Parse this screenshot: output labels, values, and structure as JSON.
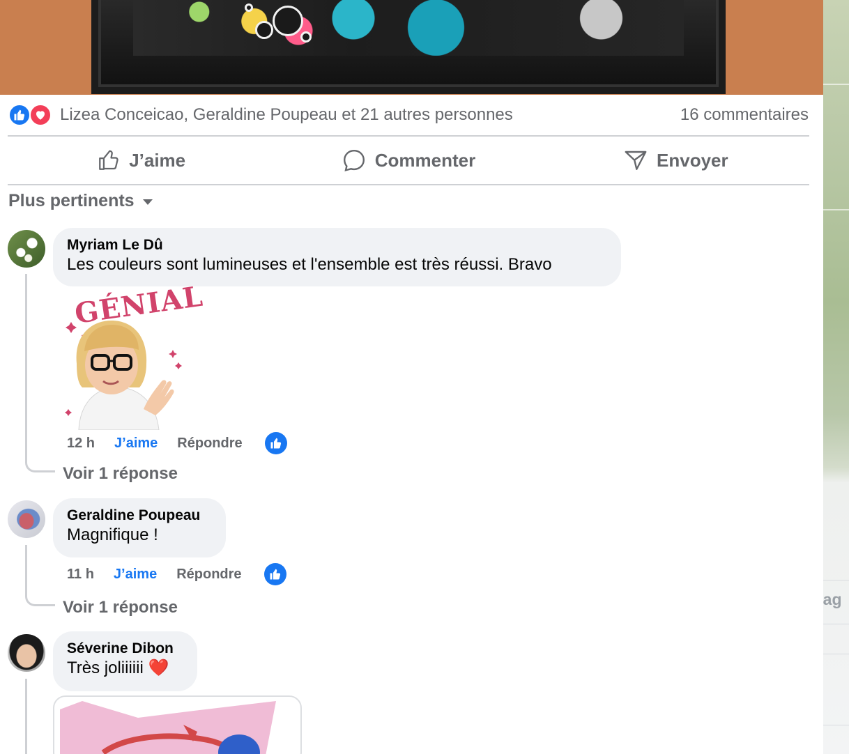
{
  "post": {
    "reactions_summary": "Lizea Conceicao, Geraldine Poupeau et 21 autres personnes",
    "comments_count": "16 commentaires"
  },
  "actions": {
    "like": "J’aime",
    "comment": "Commenter",
    "send": "Envoyer"
  },
  "sort": {
    "label": "Plus pertinents"
  },
  "comments": [
    {
      "author": "Myriam Le Dû",
      "text": "Les couleurs sont lumineuses et l'ensemble est très réussi. Bravo",
      "sticker_text": "GÉNIAL !",
      "time": "12 h",
      "like": "J’aime",
      "reply": "Répondre",
      "see_replies": "Voir 1 réponse"
    },
    {
      "author": "Geraldine Poupeau",
      "text": "Magnifique !",
      "time": "11 h",
      "like": "J’aime",
      "reply": "Répondre",
      "see_replies": "Voir 1 réponse"
    },
    {
      "author": "Séverine Dibon",
      "text": "Très joliiiiii ❤️"
    }
  ],
  "side": {
    "partial_text": "tag"
  },
  "colors": {
    "brand_blue": "#1877f2",
    "love_red": "#f33e58",
    "muted_text": "#65676b",
    "bubble_bg": "#f0f2f5"
  }
}
